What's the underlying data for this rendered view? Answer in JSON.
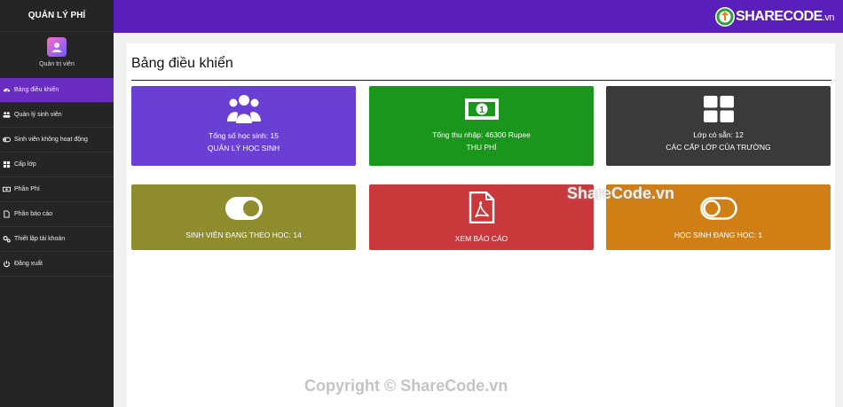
{
  "sidebar": {
    "title": "QUẢN LÝ PHÍ",
    "user": "Quản trị viên",
    "items": [
      {
        "label": "Bảng điều khiển",
        "icon": "dashboard-icon"
      },
      {
        "label": "Quản lý sinh viên",
        "icon": "users-icon"
      },
      {
        "label": "Sinh viên không hoạt động",
        "icon": "toggle-icon"
      },
      {
        "label": "Cấp lớp",
        "icon": "grid-icon"
      },
      {
        "label": "Phần Phí",
        "icon": "money-icon"
      },
      {
        "label": "Phần báo cáo",
        "icon": "file-icon"
      },
      {
        "label": "Thiết lập tài khoản",
        "icon": "gear-icon"
      },
      {
        "label": "Đăng xuất",
        "icon": "power-icon"
      }
    ]
  },
  "header": {
    "logo_text": "SHARECODE",
    "logo_suffix": ".vn"
  },
  "main": {
    "title": "Bảng điều khiển",
    "cards": [
      {
        "line1": "Tổng số học sinh: 15",
        "line2": "QUẢN LÝ HỌC SINH",
        "icon": "users-icon",
        "color": "#6a3fd3"
      },
      {
        "line1": "Tổng thu nhập: 46300 Rupee",
        "line2": "THU PHÍ",
        "icon": "money-icon",
        "color": "#1b961c"
      },
      {
        "line1": "Lớp có sẵn: 12",
        "line2": "CÁC CẤP LỚP CỦA TRƯỜNG",
        "icon": "grid-icon",
        "color": "#3a3a3a"
      },
      {
        "line1": "SINH VIÊN ĐANG THEO HỌC: 14",
        "icon": "toggle-on-icon",
        "color": "#8e8c2c"
      },
      {
        "line1": "XEM BÁO CÁO",
        "icon": "pdf-icon",
        "color": "#c9393b"
      },
      {
        "line1": "HỌC SINH ĐANG HỌC: 1",
        "icon": "toggle-off-icon",
        "color": "#cf7f14"
      }
    ]
  },
  "watermarks": {
    "mid": "ShareCode.vn",
    "bottom": "Copyright © ShareCode.vn"
  }
}
